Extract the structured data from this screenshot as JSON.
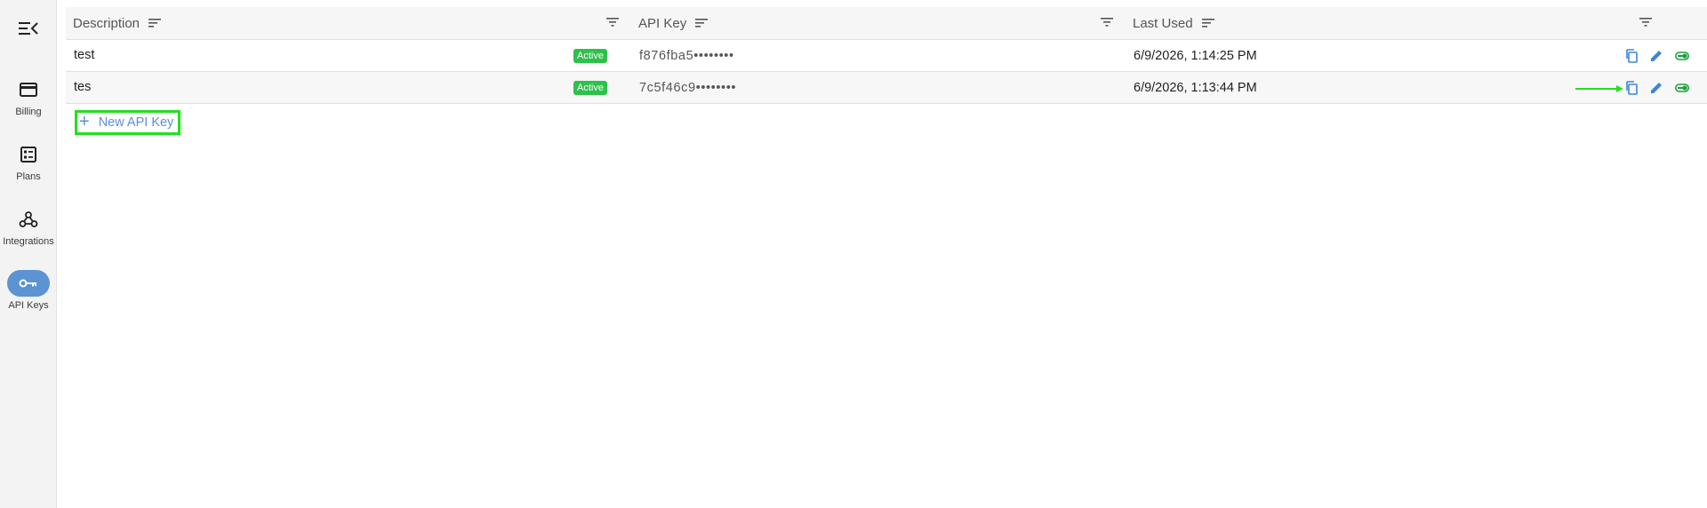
{
  "sidebar": {
    "menu_icon": "menu-collapse-icon",
    "items": [
      {
        "label": "Billing",
        "icon": "credit-card-icon",
        "active": false
      },
      {
        "label": "Plans",
        "icon": "plans-icon",
        "active": false
      },
      {
        "label": "Integrations",
        "icon": "webhook-icon",
        "active": false
      },
      {
        "label": "API Keys",
        "icon": "key-icon",
        "active": true
      }
    ]
  },
  "table": {
    "columns": [
      "Description",
      "API Key",
      "Last Used"
    ],
    "rows": [
      {
        "description": "test",
        "status": "Active",
        "key": "f876fba5••••••••",
        "last_used": "6/9/2026, 1:14:25 PM"
      },
      {
        "description": "tes",
        "status": "Active",
        "key": "7c5f46c9••••••••",
        "last_used": "6/9/2026, 1:13:44 PM"
      }
    ],
    "row_actions": [
      "copy-icon",
      "edit-icon",
      "toggle-icon"
    ]
  },
  "new_key_label": "New API Key",
  "colors": {
    "accent": "#5b93d3",
    "active_badge": "#2ec04a",
    "highlight": "#22e01e",
    "action_icon": "#3b86d6",
    "toggle": "#1aa33a"
  }
}
